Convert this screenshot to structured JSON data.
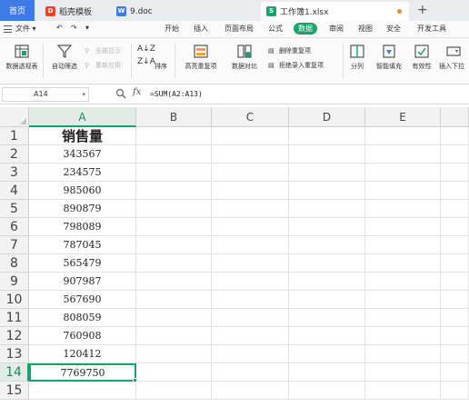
{
  "tabs": {
    "home": "首页",
    "template": "稻壳模板",
    "doc": "9.doc",
    "workbook": "工作簿1.xlsx",
    "new_tab": "+"
  },
  "menu": {
    "file": "文件",
    "items": [
      "开始",
      "插入",
      "页面布局",
      "公式",
      "数据",
      "审阅",
      "视图",
      "安全",
      "开发工具"
    ],
    "active": "数据"
  },
  "ribbon": {
    "pivot_table": "数据透视表",
    "auto_filter": "自动筛选",
    "show_all": "全部显示",
    "reapply": "重新应用",
    "sort": "排序",
    "highlight_duplicates": "高亮重复项",
    "data_compare": "数据对比",
    "remove_duplicates": "删除重复项",
    "reject_duplicates": "拒绝录入重复项",
    "split_column": "分列",
    "smart_fill": "智能填充",
    "validation": "有效性",
    "insert_dropdown": "插入下拉"
  },
  "formula_bar": {
    "cell_ref": "A14",
    "fx": "fx",
    "formula": "=SUM(A2:A13)"
  },
  "grid": {
    "columns": [
      "A",
      "B",
      "C",
      "D",
      "E"
    ],
    "rows": [
      "1",
      "2",
      "3",
      "4",
      "5",
      "6",
      "7",
      "8",
      "9",
      "10",
      "11",
      "12",
      "13",
      "14",
      "15"
    ],
    "column_a": [
      "销售量",
      "343567",
      "234575",
      "985060",
      "890879",
      "798089",
      "787045",
      "565479",
      "907987",
      "567690",
      "808059",
      "760908",
      "120412",
      "7769750",
      ""
    ],
    "selected_cell": "A14"
  },
  "colors": {
    "accent": "#1aa26a",
    "home_tab": "#3d7be5"
  }
}
